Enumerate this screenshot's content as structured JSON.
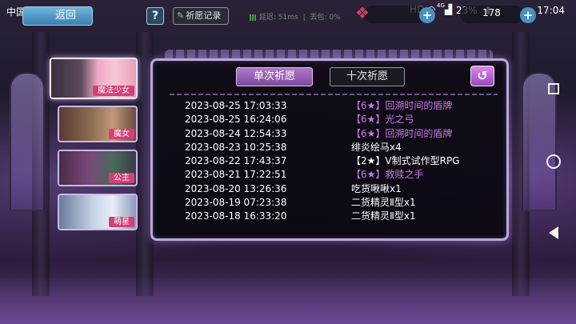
{
  "status_bar": {
    "carrier": "中国移动",
    "battery": "23%",
    "time": "17:04",
    "network_label": "4G",
    "icons": [
      "hd-icon",
      "wifi-icon",
      "signal-icon",
      "battery-icon"
    ]
  },
  "toolbar": {
    "back_label": "返回",
    "help_label": "?",
    "record_label": "祈愿记录",
    "net_latency": "延迟: 51ms",
    "packet_loss": "丢包: 0%",
    "currency_value": "178"
  },
  "sidebar": {
    "tabs": [
      {
        "label": "魔法少女",
        "active": true
      },
      {
        "label": "魔女",
        "active": false
      },
      {
        "label": "公主",
        "active": false
      },
      {
        "label": "萌星",
        "active": false
      }
    ]
  },
  "panel": {
    "tab_single": "单次祈愿",
    "tab_ten": "十次祈愿",
    "records": [
      {
        "date": "2023-08-25 17:03:33",
        "item": "【6★】回溯时间的盾牌",
        "highlight": true
      },
      {
        "date": "2023-08-25 16:24:06",
        "item": "【6★】光之弓",
        "highlight": true
      },
      {
        "date": "2023-08-24 12:54:33",
        "item": "【6★】回溯时间的盾牌",
        "highlight": true
      },
      {
        "date": "2023-08-23 10:25:38",
        "item": "绯炎绘马x4",
        "highlight": false
      },
      {
        "date": "2023-08-22 17:43:37",
        "item": "【2★】V制式试作型RPG",
        "highlight": false
      },
      {
        "date": "2023-08-21 17:22:51",
        "item": "【6★】救赎之手",
        "highlight": true
      },
      {
        "date": "2023-08-20 13:26:36",
        "item": "吃货啾啾x1",
        "highlight": false
      },
      {
        "date": "2023-08-19 07:23:38",
        "item": "二货精灵Ⅱ型x1",
        "highlight": false
      },
      {
        "date": "2023-08-18 16:33:20",
        "item": "二货精灵Ⅱ型x1",
        "highlight": false
      }
    ]
  },
  "colors": {
    "highlight_text": "#c878e8",
    "accent_purple": "#9b47c0",
    "back_button_blue": "#3b7fb0"
  }
}
